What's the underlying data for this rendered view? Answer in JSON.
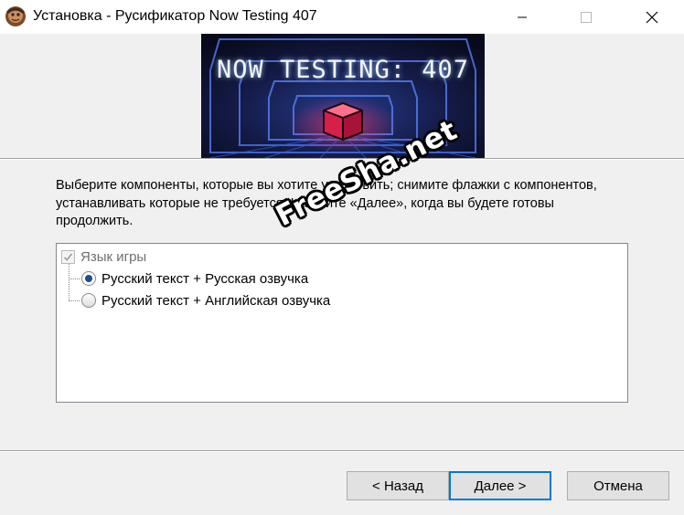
{
  "window": {
    "title": "Установка - Русификатор Now Testing 407",
    "icon": "installer-icon",
    "controls": {
      "minimize": "minimize-icon",
      "maximize": "maximize-icon",
      "close": "close-icon"
    }
  },
  "banner": {
    "title": "NOW TESTING: 407",
    "colors": {
      "background": "#10132b",
      "cube": "#e0224f",
      "glow": "#3a6cff"
    }
  },
  "instructions": "Выберите компоненты, которые вы хотите установить; снимите флажки с компонентов, устанавливать которые не требуется. Нажмите «Далее», когда вы будете готовы продолжить.",
  "components": {
    "group": {
      "label": "Язык игры",
      "checked": true,
      "disabled": true
    },
    "options": [
      {
        "label": "Русский текст + Русская озвучка",
        "selected": true
      },
      {
        "label": "Русский текст + Английская озвучка",
        "selected": false
      }
    ]
  },
  "buttons": {
    "back": "< Назад",
    "next": "Далее >",
    "cancel": "Отмена"
  },
  "watermark": "FreeSha.net",
  "colors": {
    "accent": "#0078d7",
    "window": "#f0f0f0"
  }
}
